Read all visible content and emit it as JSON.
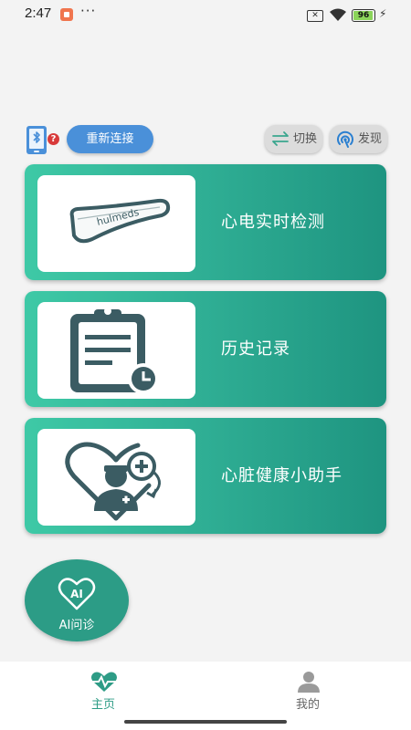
{
  "status_bar": {
    "time": "2:47",
    "more": "···",
    "battery_level": "96",
    "icons": [
      "notification-app-icon",
      "sim-x-icon",
      "wifi-icon",
      "battery-icon",
      "charging-bolt-icon"
    ]
  },
  "toolbar": {
    "help_badge": "?",
    "reconnect_label": "重新连接",
    "switch_label": "切换",
    "discover_label": "发现"
  },
  "cards": [
    {
      "title": "心电实时检测",
      "thumb_logo_text": "hulmeds",
      "icon": "ecg-patch-device-icon"
    },
    {
      "title": "历史记录",
      "icon": "clipboard-clock-icon"
    },
    {
      "title": "心脏健康小助手",
      "icon": "doctor-heart-icon"
    }
  ],
  "ai": {
    "badge": "AI",
    "label": "AI问诊"
  },
  "nav": {
    "items": [
      {
        "label": "主页",
        "icon": "heart-pulse-icon",
        "active": true
      },
      {
        "label": "我的",
        "icon": "user-icon",
        "active": false
      }
    ]
  },
  "colors": {
    "accent": "#2e9c86",
    "card_gradient_start": "#3ec9a6",
    "card_gradient_end": "#1e9480",
    "reconnect_button": "#4a90d9",
    "icon_dark": "#3b5c63"
  }
}
